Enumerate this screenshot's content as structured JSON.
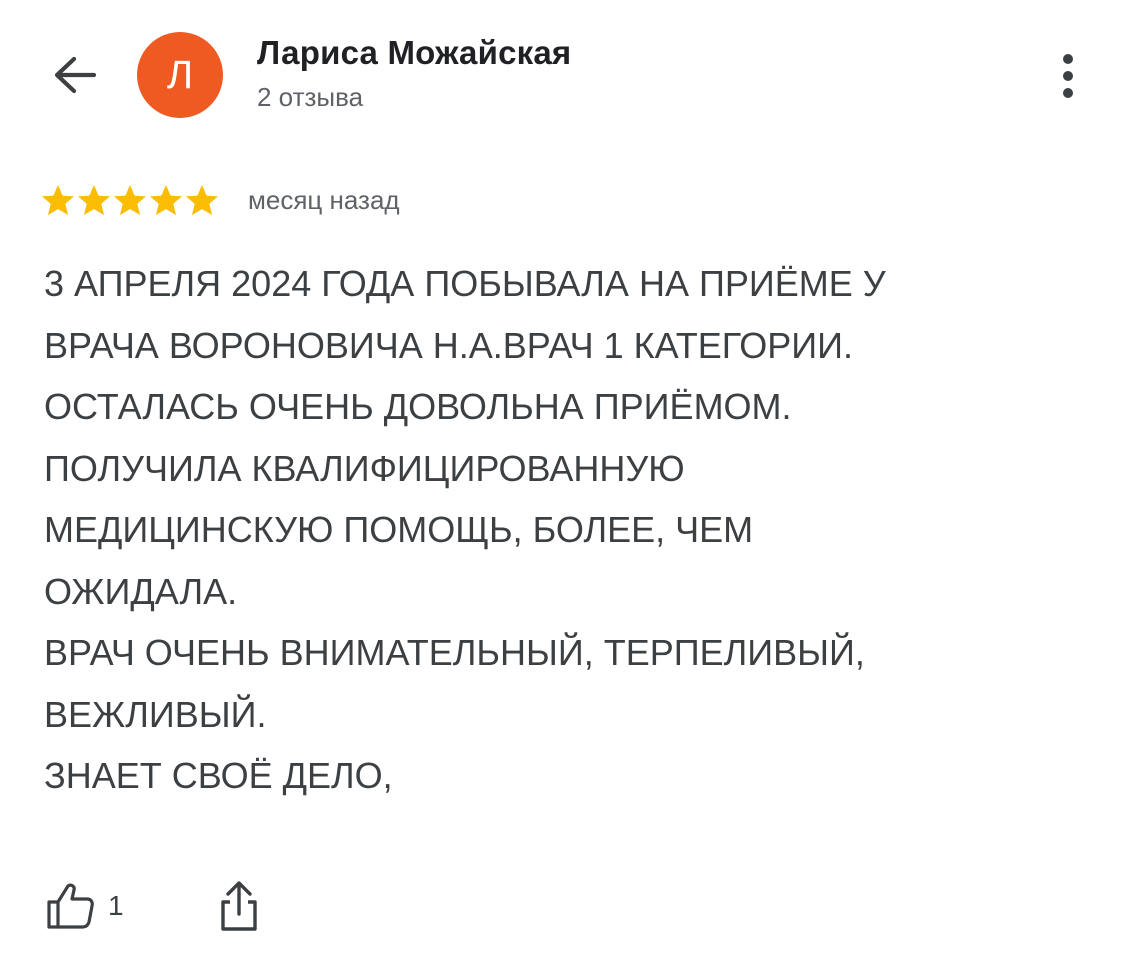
{
  "header": {
    "back_icon": "arrow-left-icon",
    "avatar_letter": "Л",
    "avatar_color": "#ee5a22",
    "author_name": "Лариса Можайская",
    "review_count": "2 отзыва",
    "more_icon": "more-vert-icon"
  },
  "review": {
    "rating": 5,
    "rating_max": 5,
    "star_color": "#fbbc04",
    "time": "месяц назад",
    "lines": [
      "3 АПРЕЛЯ 2024 ГОДА ПОБЫВАЛА НА ПРИЁМЕ У",
      "ВРАЧА ВОРОНОВИЧА Н.А.ВРАЧ 1 КАТЕГОРИИ.",
      "ОСТАЛАСЬ ОЧЕНЬ ДОВОЛЬНА ПРИЁМОМ.",
      "ПОЛУЧИЛА КВАЛИФИЦИРОВАННУЮ",
      "МЕДИЦИНСКУЮ ПОМОЩЬ, БОЛЕЕ, ЧЕМ",
      "ОЖИДАЛА.",
      "ВРАЧ ОЧЕНЬ ВНИМАТЕЛЬНЫЙ, ТЕРПЕЛИВЫЙ,",
      "ВЕЖЛИВЫЙ.",
      "ЗНАЕТ СВОЁ ДЕЛО,"
    ]
  },
  "actions": {
    "like_icon": "thumb-up-icon",
    "like_count": "1",
    "share_icon": "share-icon"
  }
}
